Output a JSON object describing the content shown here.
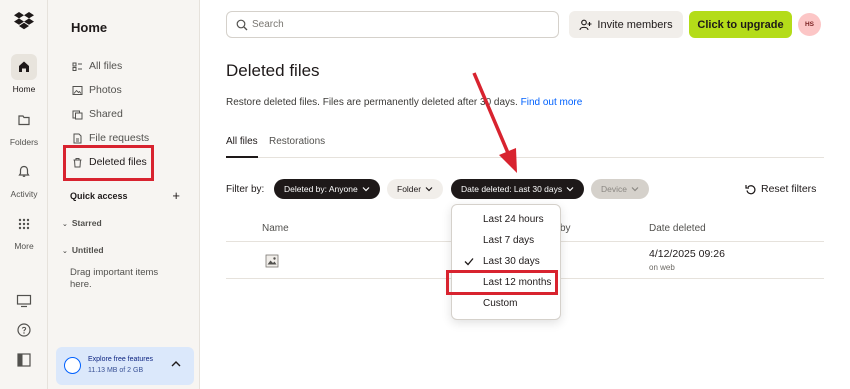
{
  "rail": {
    "items": [
      {
        "label": "Home",
        "icon": "home-icon"
      },
      {
        "label": "Folders",
        "icon": "folder-icon"
      },
      {
        "label": "Activity",
        "icon": "bell-icon"
      },
      {
        "label": "More",
        "icon": "grid-icon"
      }
    ],
    "bottom_icons": [
      "desktop-icon",
      "help-icon",
      "panel-icon"
    ]
  },
  "sidebar": {
    "title": "Home",
    "items": [
      {
        "label": "All files",
        "icon": "all-files-icon"
      },
      {
        "label": "Photos",
        "icon": "photos-icon"
      },
      {
        "label": "Shared",
        "icon": "shared-icon"
      },
      {
        "label": "File requests",
        "icon": "file-requests-icon"
      },
      {
        "label": "Deleted files",
        "icon": "trash-icon"
      }
    ],
    "quick_access": "Quick access",
    "quick_add": "+",
    "starred": "Starred",
    "untitled": "Untitled",
    "drag_hint": "Drag important items here.",
    "storage": {
      "title": "Explore free features",
      "usage": "11.13 MB of 2 GB"
    }
  },
  "topbar": {
    "search_placeholder": "Search",
    "invite_label": "Invite members",
    "upgrade_label": "Click to upgrade",
    "avatar_initials": "HS",
    "upgrade_color": "#b4dc19"
  },
  "main": {
    "title": "Deleted files",
    "description": "Restore deleted files. Files are permanently deleted after 30 days.",
    "description_link": "Find out more",
    "tabs": [
      "All files",
      "Restorations"
    ],
    "filter_label": "Filter by:",
    "filters": {
      "deleted_by": "Deleted by: Anyone",
      "folder": "Folder",
      "date_deleted": "Date deleted: Last 30 days",
      "device": "Device"
    },
    "reset_label": "Reset filters",
    "table": {
      "headers": {
        "name": "Name",
        "deleted_by_partial": "by",
        "date": "Date deleted"
      },
      "rows": [
        {
          "date": "4/12/2025 09:26",
          "sub": "on web"
        }
      ]
    }
  },
  "dropdown": {
    "options": [
      "Last 24 hours",
      "Last 7 days",
      "Last 30 days",
      "Last 12 months",
      "Custom"
    ],
    "selected": "Last 30 days"
  },
  "annotations": {
    "highlight_color": "#d8232f"
  }
}
